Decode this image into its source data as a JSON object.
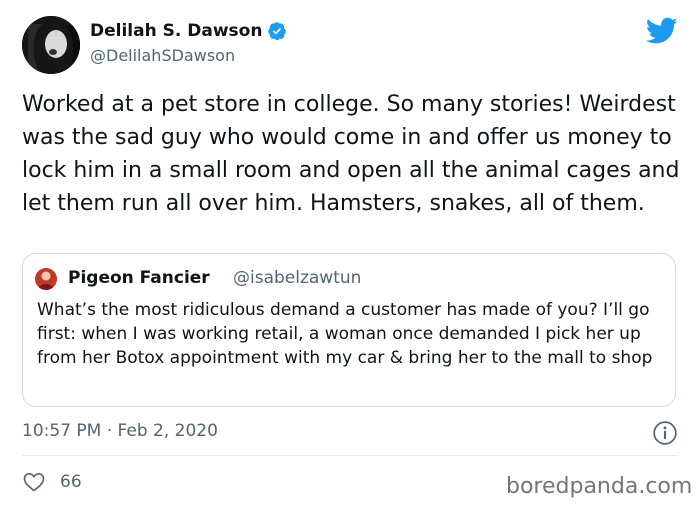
{
  "author": {
    "name": "Delilah S. Dawson",
    "handle": "@DelilahSDawson"
  },
  "tweet": {
    "text": "Worked at a pet store in college. So many stories! Weirdest was the sad guy who would come in and offer us money to lock him in a small room and open all the animal cages and let them run all over him. Hamsters, snakes, all of them.",
    "timestamp": "10:57 PM · Feb 2, 2020",
    "likes": "66"
  },
  "quoted_tweet": {
    "name": "Pigeon Fancier",
    "handle": "@isabelzawtun",
    "text": "What’s the most ridiculous demand a customer has made of you? I’ll go first: when I was working retail, a woman once demanded I pick her up from her Botox appointment with my car & bring her to the mall to shop"
  },
  "watermark": "boredpanda.com",
  "icons": {
    "verified": "verified-badge-icon",
    "brand": "twitter-bird-icon",
    "info": "info-icon",
    "like": "heart-icon"
  },
  "colors": {
    "twitter_blue": "#1d9bf0",
    "text": "#0f1419",
    "secondary": "#536471",
    "border": "#cfd9de"
  }
}
